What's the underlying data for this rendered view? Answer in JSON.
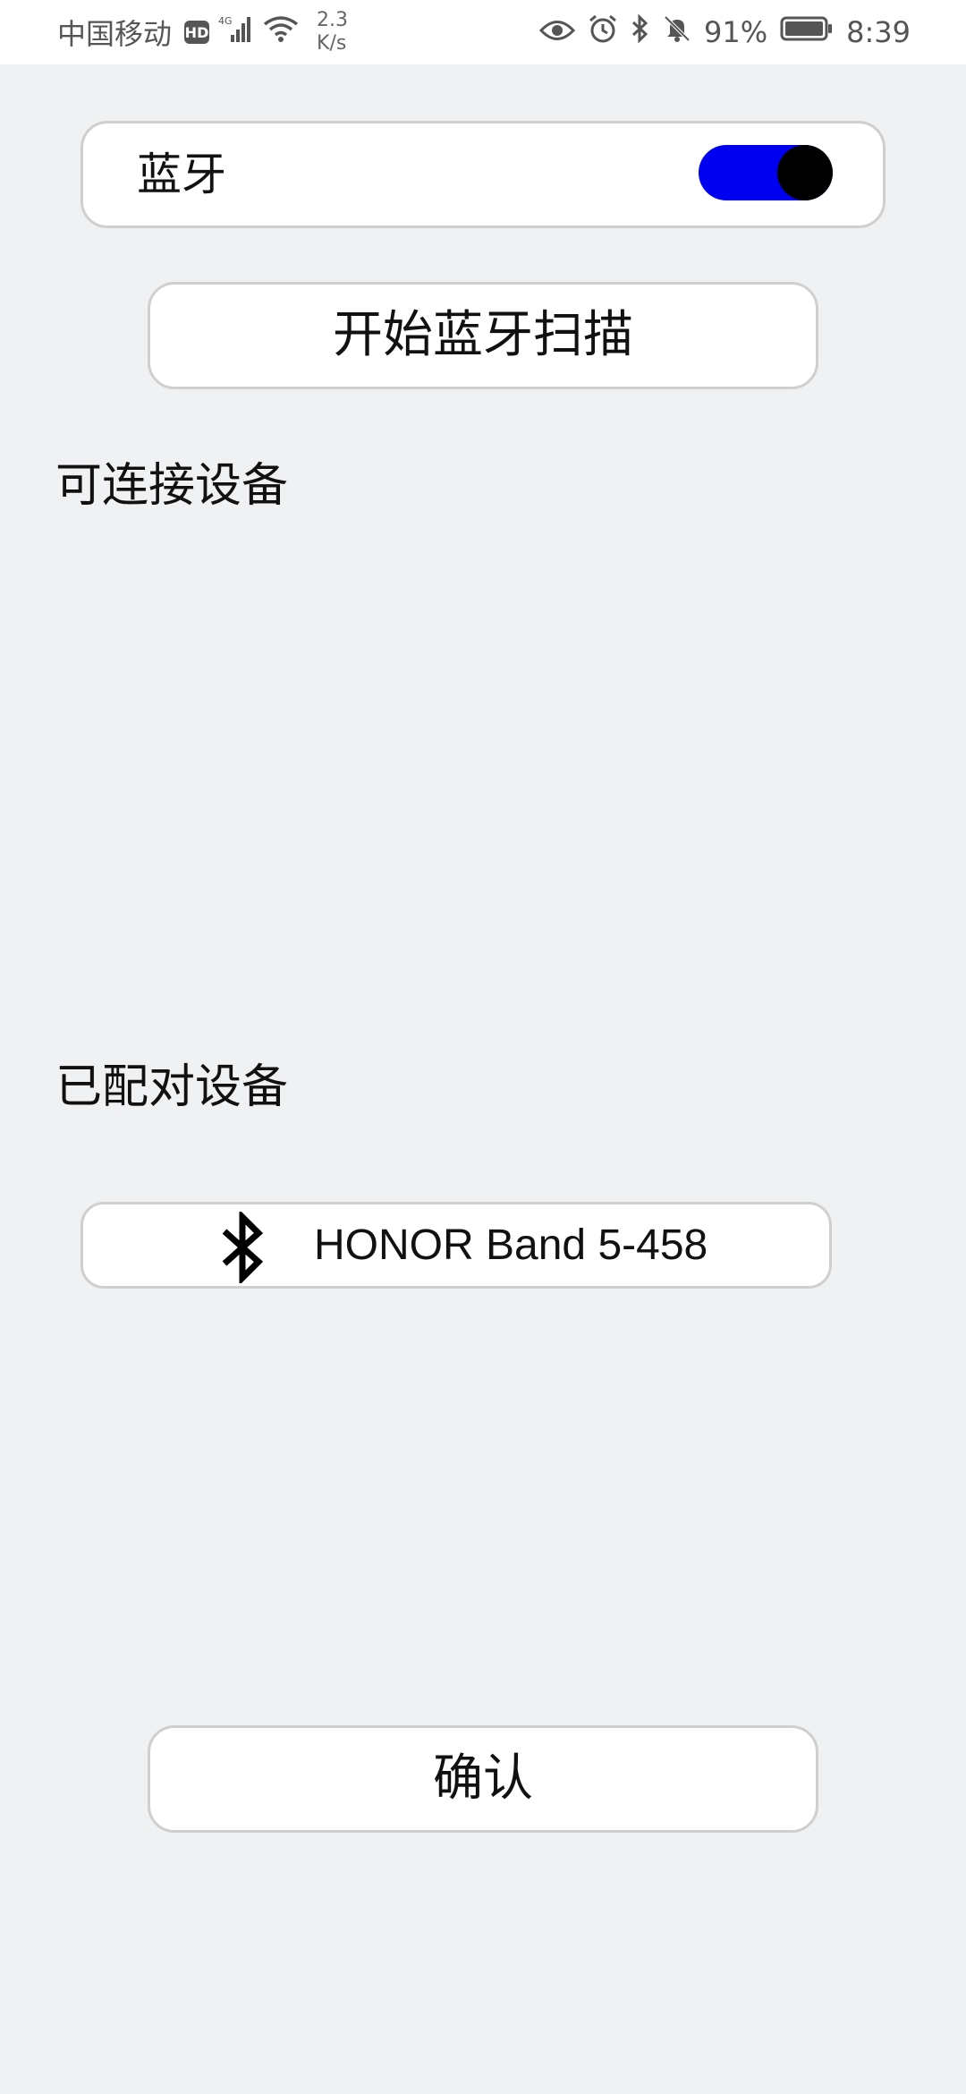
{
  "status_bar": {
    "carrier": "中国移动",
    "hd_badge": "HD",
    "signal_label": "4G",
    "net_speed_value": "2.3",
    "net_speed_unit": "K/s",
    "battery": "91%",
    "time": "8:39"
  },
  "bluetooth": {
    "label": "蓝牙",
    "enabled": true,
    "toggle_color": "#0000f0"
  },
  "scan_button": {
    "label": "开始蓝牙扫描"
  },
  "available_devices": {
    "title": "可连接设备",
    "items": []
  },
  "paired_devices": {
    "title": "已配对设备",
    "items": [
      {
        "icon": "bluetooth-icon",
        "name": "HONOR Band 5-458"
      }
    ]
  },
  "confirm_button": {
    "label": "确认"
  }
}
